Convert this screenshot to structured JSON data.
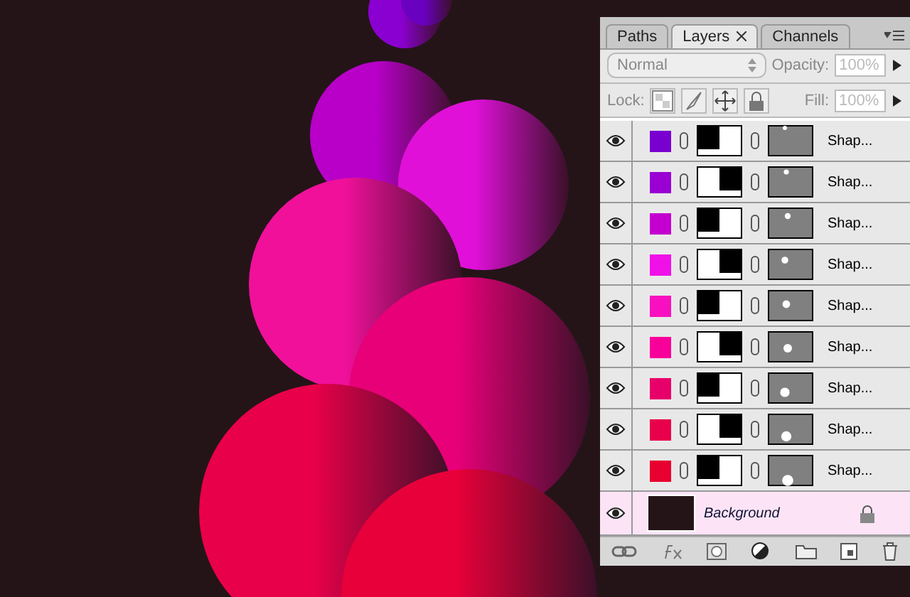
{
  "panel": {
    "tabs": [
      {
        "label": "Paths",
        "selected": false
      },
      {
        "label": "Layers",
        "selected": true
      },
      {
        "label": "Channels",
        "selected": false
      }
    ],
    "blend_mode": "Normal",
    "opacity_label": "Opacity:",
    "opacity": "100%",
    "lock_label": "Lock:",
    "fill_label": "Fill:",
    "fill": "100%",
    "layers": [
      {
        "name": "Shap...",
        "color": "#7a00d0",
        "visible": true,
        "selected": false,
        "locked": false
      },
      {
        "name": "Shap...",
        "color": "#9a00d4",
        "visible": true,
        "selected": false,
        "locked": false
      },
      {
        "name": "Shap...",
        "color": "#c400d0",
        "visible": true,
        "selected": false,
        "locked": false
      },
      {
        "name": "Shap...",
        "color": "#f010e8",
        "visible": true,
        "selected": false,
        "locked": false
      },
      {
        "name": "Shap...",
        "color": "#f810c0",
        "visible": true,
        "selected": false,
        "locked": false
      },
      {
        "name": "Shap...",
        "color": "#f8009a",
        "visible": true,
        "selected": false,
        "locked": false
      },
      {
        "name": "Shap...",
        "color": "#e8006a",
        "visible": true,
        "selected": false,
        "locked": false
      },
      {
        "name": "Shap...",
        "color": "#e8004c",
        "visible": true,
        "selected": false,
        "locked": false
      },
      {
        "name": "Shap...",
        "color": "#e80030",
        "visible": true,
        "selected": false,
        "locked": false
      },
      {
        "name": "Background",
        "color": "#241418",
        "visible": true,
        "selected": true,
        "locked": true
      }
    ]
  }
}
